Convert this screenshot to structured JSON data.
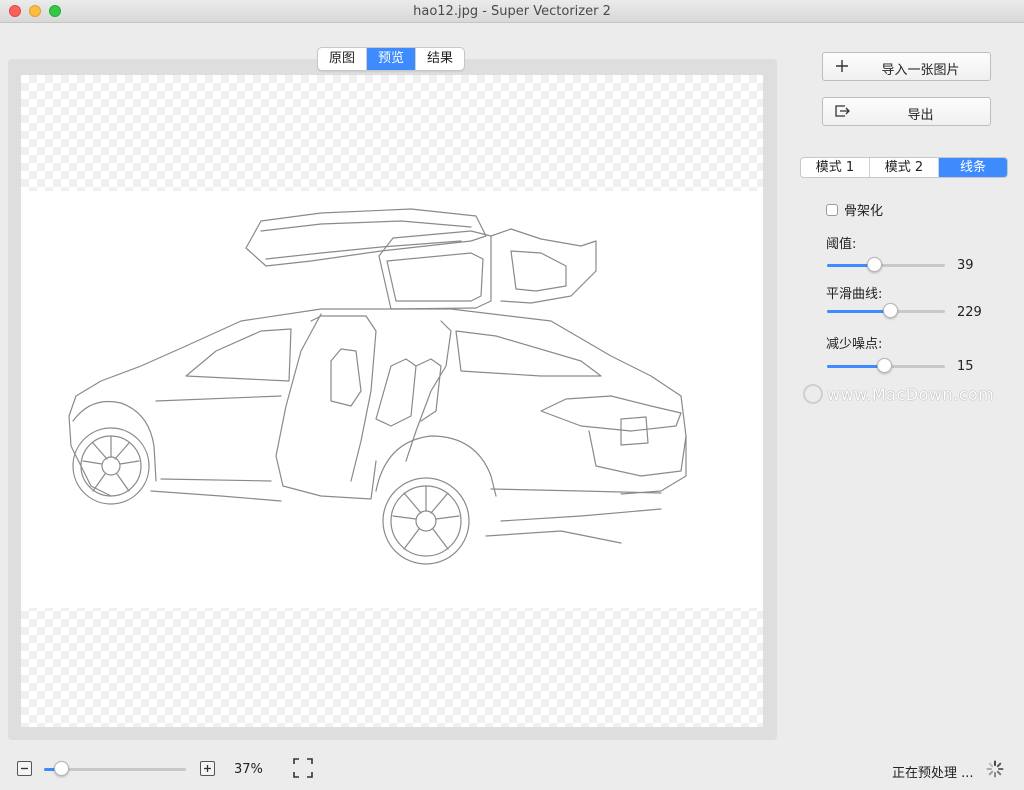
{
  "window": {
    "title": "hao12.jpg - Super Vectorizer 2"
  },
  "view_tabs": [
    {
      "label": "原图",
      "active": false
    },
    {
      "label": "预览",
      "active": true
    },
    {
      "label": "结果",
      "active": false
    }
  ],
  "actions": {
    "import_label": "导入一张图片",
    "export_label": "导出"
  },
  "mode_tabs": [
    {
      "label": "模式 1",
      "active": false
    },
    {
      "label": "模式 2",
      "active": false
    },
    {
      "label": "线条",
      "active": true
    }
  ],
  "options": {
    "skeletonize_label": "骨架化",
    "skeletonize_checked": false
  },
  "params": {
    "threshold": {
      "label": "阈值:",
      "value": "39",
      "fraction": 0.4
    },
    "smooth": {
      "label": "平滑曲线:",
      "value": "229",
      "fraction": 0.53
    },
    "denoise": {
      "label": "减少噪点:",
      "value": "15",
      "fraction": 0.48
    }
  },
  "watermark": {
    "text": "www.MacDown.com"
  },
  "zoom": {
    "level": "37%",
    "fraction": 0.12
  },
  "status": {
    "text": "正在预处理 ..."
  },
  "colors": {
    "accent": "#3d8bfd",
    "window_bg": "#ececec"
  },
  "icons": {
    "import": "plus-icon",
    "export": "export-icon",
    "zoom_out": "minus-icon",
    "zoom_in": "plus-icon",
    "fit": "fit-screen-icon",
    "busy": "spinner-icon"
  }
}
